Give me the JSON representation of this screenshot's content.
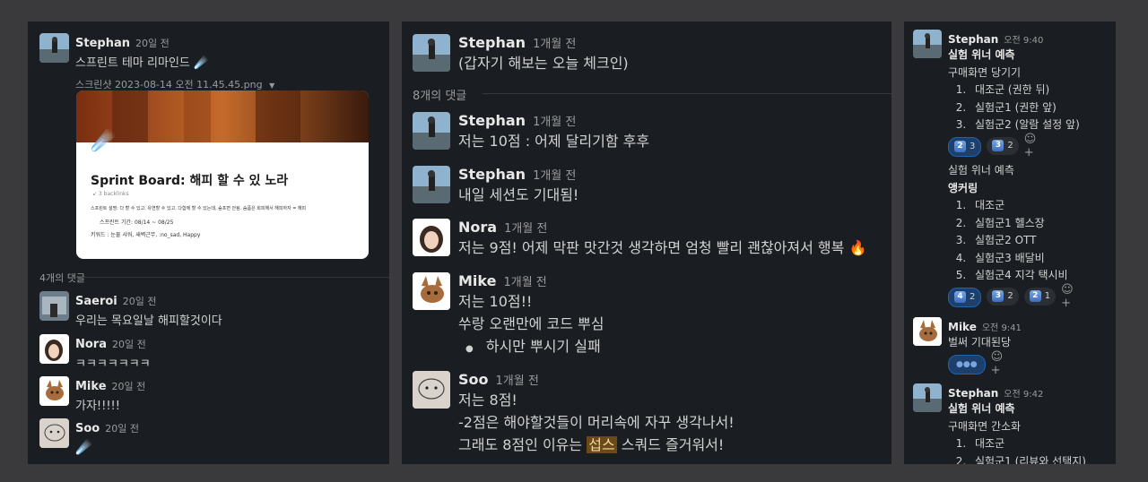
{
  "panel1": {
    "message": {
      "author": "Stephan",
      "time": "20일 전",
      "text": "스프린트 테마 리마인드 ☄️",
      "attachment_name": "스크린샷 2023-08-14 오전 11.45.45.png",
      "card": {
        "title": "Sprint Board: 해피 할 수 있 노라",
        "backlinks": "↙ 3 backlinks",
        "desc": "스프린트 설명: 다 할 수 있고, 유연할 수 있고, 다함께 할 수 있는데, 숨프면 안됨. 숨픔은 회피해서 해피하자 = 해피",
        "period": "스프린트 기간: 08/14 ~ 08/25",
        "keywords": "키워드 : 눈물 샤워, 새벽근무, :no_sad, Happy"
      }
    },
    "reply_count": "4개의 댓글",
    "replies": [
      {
        "author": "Saeroi",
        "time": "20일 전",
        "text": "우리는 목요일날 해피할것이다"
      },
      {
        "author": "Nora",
        "time": "20일 전",
        "text": "ㅋㅋㅋㅋㅋㅋㅋ"
      },
      {
        "author": "Mike",
        "time": "20일 전",
        "text": "가자!!!!!"
      },
      {
        "author": "Soo",
        "time": "20일 전",
        "text": "☄️"
      }
    ]
  },
  "panel2": {
    "message": {
      "author": "Stephan",
      "time": "1개월 전",
      "text": "(갑자기 해보는 오늘 체크인)"
    },
    "reply_count": "8개의 댓글",
    "replies": [
      {
        "author": "Stephan",
        "time": "1개월 전",
        "text": "저는 10점 : 어제 달리기함 후후"
      },
      {
        "author": "Stephan",
        "time": "1개월 전",
        "text": "내일 세션도 기대됨!"
      },
      {
        "author": "Nora",
        "time": "1개월 전",
        "text": "저는 9점! 어제 막판 맛간것 생각하면 엄청 빨리 괜찮아져서 행복 🔥"
      },
      {
        "author": "Mike",
        "time": "1개월 전",
        "line1": "저는 10점!!",
        "line2": "쑤랑 오랜만에 코드 뿌심",
        "bullet": "하시만 뿌시기 실패"
      },
      {
        "author": "Soo",
        "time": "1개월 전",
        "line1": "저는 8점!",
        "line2": "-2점은 해야할것들이 머리속에 자꾸 생각나서!",
        "line3_pre": "그래도 8점인 이유는",
        "line3_highlight": "섭스",
        "line3_post": "스쿼드 즐거워서!"
      }
    ]
  },
  "panel3": {
    "posts": [
      {
        "author": "Stephan",
        "time": "오전 9:40",
        "heading": "실험 위너 예측",
        "subheading": "구매화면 당기기",
        "items": [
          "대조군 (권한 뒤)",
          "실험군1 (권한 앞)",
          "실험군2 (알람 설정 앞)"
        ],
        "reactions": [
          {
            "emoji": "2",
            "count": "3",
            "mine": true
          },
          {
            "emoji": "3",
            "count": "2",
            "mine": false
          }
        ]
      },
      {
        "heading": "실험 위너 예측",
        "subheading": "앵커링",
        "items": [
          "대조군",
          "실험군1 헬스장",
          "실험군2 OTT",
          "실험군3 배달비",
          "실험군4 지각 택시비"
        ],
        "reactions": [
          {
            "emoji": "4",
            "count": "2",
            "mine": true
          },
          {
            "emoji": "3",
            "count": "2",
            "mine": false
          },
          {
            "emoji": "2",
            "count": "1",
            "mine": false
          }
        ]
      },
      {
        "author": "Mike",
        "time": "오전 9:41",
        "text": "벌써 기대된당",
        "reaction_count": "1"
      },
      {
        "author": "Stephan",
        "time": "오전 9:42",
        "heading": "실험 위너 예측",
        "subheading": "구매화면 간소화",
        "items": [
          "대조군",
          "실험군1 (리뷰와 선택지)"
        ]
      }
    ]
  }
}
